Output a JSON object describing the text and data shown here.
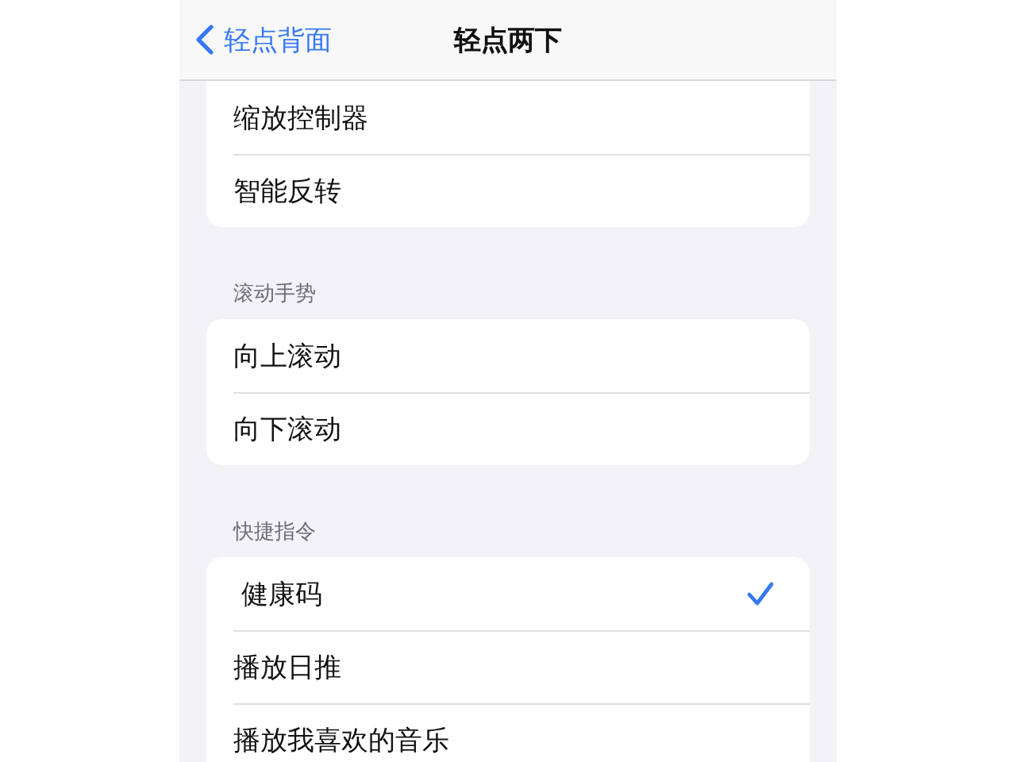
{
  "nav_bar": {
    "back_label": "轻点背面",
    "title": "轻点两下"
  },
  "sections": [
    {
      "items": [
        {
          "label": "缩放控制器",
          "selected": false
        },
        {
          "label": "智能反转",
          "selected": false
        }
      ]
    },
    {
      "header": "滚动手势",
      "items": [
        {
          "label": "向上滚动",
          "selected": false
        },
        {
          "label": "向下滚动",
          "selected": false
        }
      ]
    },
    {
      "header": "快捷指令",
      "items": [
        {
          "label": "健康码",
          "selected": true
        },
        {
          "label": "播放日推",
          "selected": false
        },
        {
          "label": "播放我喜欢的音乐",
          "selected": false
        }
      ]
    }
  ]
}
